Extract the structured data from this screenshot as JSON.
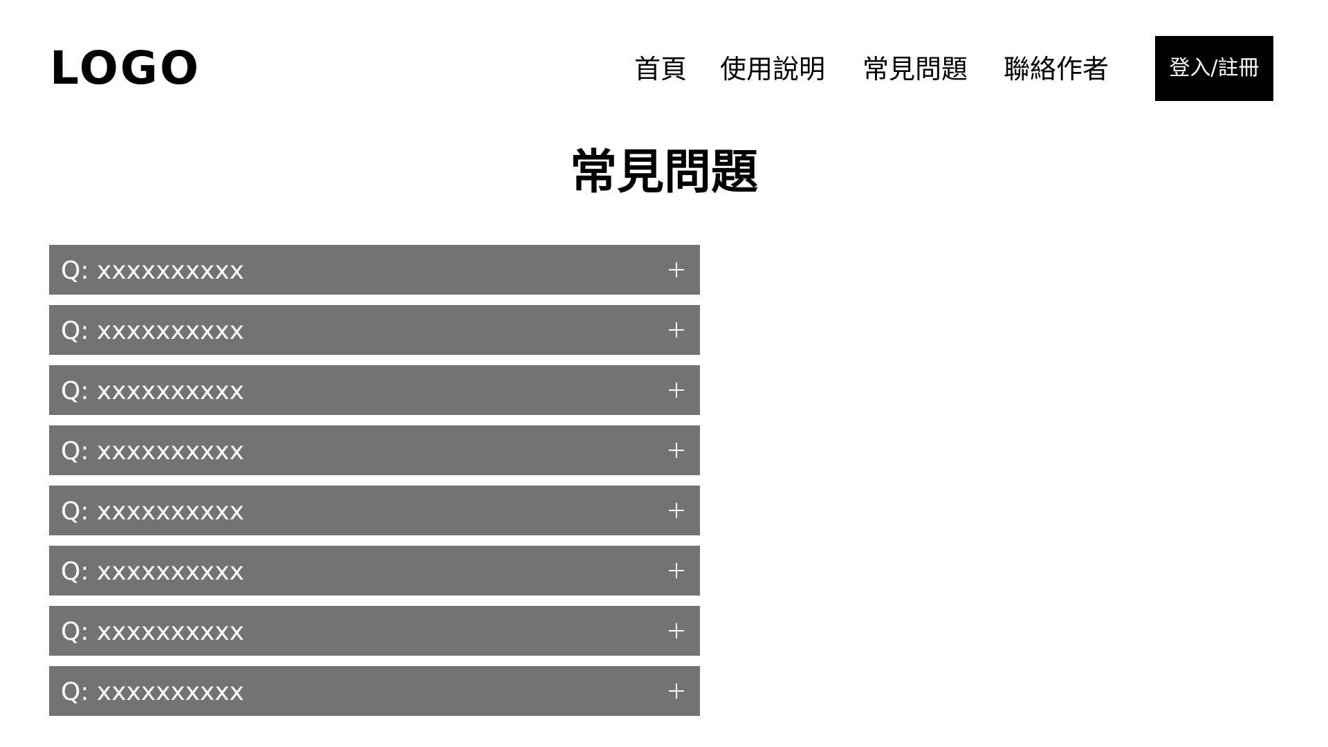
{
  "header": {
    "logo": "LOGO",
    "nav": {
      "home": "首頁",
      "guide": "使用說明",
      "faq": "常見問題",
      "contact": "聯絡作者"
    },
    "login_label": "登入/註冊"
  },
  "main": {
    "title": "常見問題",
    "faq_items": [
      {
        "question": "Q: xxxxxxxxxx",
        "icon": "plus-icon"
      },
      {
        "question": "Q: xxxxxxxxxx",
        "icon": "plus-icon"
      },
      {
        "question": "Q: xxxxxxxxxx",
        "icon": "plus-icon"
      },
      {
        "question": "Q: xxxxxxxxxx",
        "icon": "plus-icon"
      },
      {
        "question": "Q: xxxxxxxxxx",
        "icon": "plus-icon"
      },
      {
        "question": "Q: xxxxxxxxxx",
        "icon": "plus-icon"
      },
      {
        "question": "Q: xxxxxxxxxx",
        "icon": "plus-icon"
      },
      {
        "question": "Q: xxxxxxxxxx",
        "icon": "plus-icon"
      }
    ]
  },
  "colors": {
    "background": "#ffffff",
    "text": "#000000",
    "button_bg": "#000000",
    "button_text": "#ffffff",
    "faq_item_bg": "#737373",
    "faq_item_text": "#ffffff"
  }
}
